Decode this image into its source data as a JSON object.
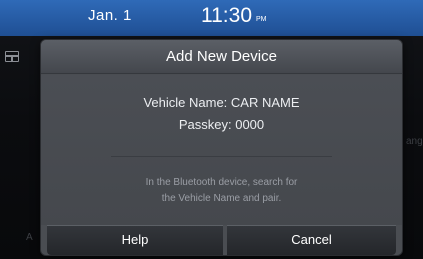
{
  "status_bar": {
    "date": "Jan.  1",
    "time": "11:30",
    "ampm": "PM"
  },
  "background": {
    "right_fragment": "ang",
    "left_fragment": "A"
  },
  "dialog": {
    "title": "Add New Device",
    "vehicle_name_line": "Vehicle Name: CAR NAME",
    "passkey_line": "Passkey: 0000",
    "hint_line_1": "In the Bluetooth device, search for",
    "hint_line_2": "the Vehicle Name and pair.",
    "help_label": "Help",
    "cancel_label": "Cancel"
  }
}
